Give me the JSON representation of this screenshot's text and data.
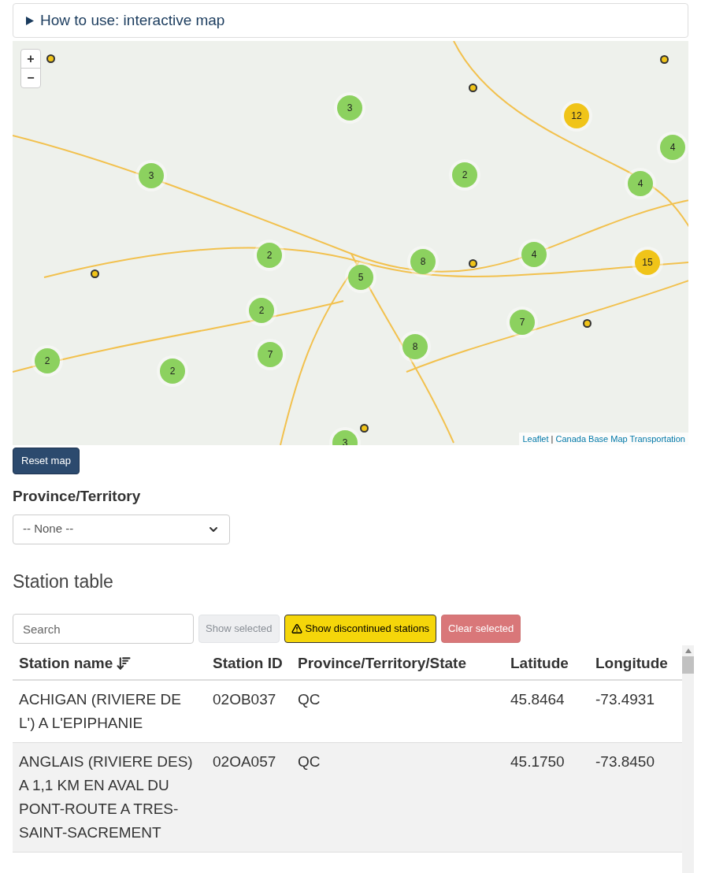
{
  "help": {
    "label": "How to use: interactive map",
    "expanded": false
  },
  "map": {
    "zoom_in": "+",
    "zoom_out": "−",
    "attribution": [
      {
        "kind": "link",
        "text": "Leaflet"
      },
      {
        "kind": "separator",
        "text": " | "
      },
      {
        "kind": "link",
        "text": "Canada Base Map Transportation"
      }
    ],
    "clusters": [
      {
        "count": "3",
        "color": "#8cd15f"
      },
      {
        "count": "12",
        "color": "#f0c419"
      },
      {
        "count": "4",
        "color": "#8cd15f"
      },
      {
        "count": "3",
        "color": "#8cd15f"
      },
      {
        "count": "2",
        "color": "#8cd15f"
      },
      {
        "count": "4",
        "color": "#8cd15f"
      },
      {
        "count": "2",
        "color": "#8cd15f"
      },
      {
        "count": "8",
        "color": "#8cd15f"
      },
      {
        "count": "4",
        "color": "#8cd15f"
      },
      {
        "count": "5",
        "color": "#8cd15f"
      },
      {
        "count": "15",
        "color": "#f0c419"
      },
      {
        "count": "2",
        "color": "#8cd15f"
      },
      {
        "count": "7",
        "color": "#8cd15f"
      },
      {
        "count": "2",
        "color": "#8cd15f"
      },
      {
        "count": "7",
        "color": "#8cd15f"
      },
      {
        "count": "8",
        "color": "#8cd15f"
      },
      {
        "count": "2",
        "color": "#8cd15f"
      },
      {
        "count": "3",
        "color": "#8cd15f"
      }
    ]
  },
  "reset_button": "Reset map",
  "province": {
    "label": "Province/Territory",
    "value": "-- None --"
  },
  "section_title": "Station table",
  "toolbar": {
    "search_placeholder": "Search",
    "buttons": [
      {
        "kind": "show",
        "label": "Show selected",
        "disabled": true
      },
      {
        "kind": "warn",
        "label": "Show discontinued stations",
        "disabled": false
      },
      {
        "kind": "clear",
        "label": "Clear selected",
        "disabled": true
      }
    ]
  },
  "table": {
    "columns": [
      {
        "label": "Station name",
        "sorted": true
      },
      {
        "label": "Station ID",
        "sorted": false
      },
      {
        "label": "Province/Territory/State",
        "sorted": false
      },
      {
        "label": "Latitude",
        "sorted": false
      },
      {
        "label": "Longitude",
        "sorted": false
      }
    ],
    "rows": [
      [
        "ACHIGAN (RIVIERE DE L') A L'EPIPHANIE",
        "02OB037",
        "QC",
        "45.8464",
        "-73.4931"
      ],
      [
        "ANGLAIS (RIVIERE DES) A 1,1 KM EN AVAL DU PONT-ROUTE A TRES-SAINT-SACREMENT",
        "02OA057",
        "QC",
        "45.1750",
        "-73.8450"
      ]
    ]
  }
}
